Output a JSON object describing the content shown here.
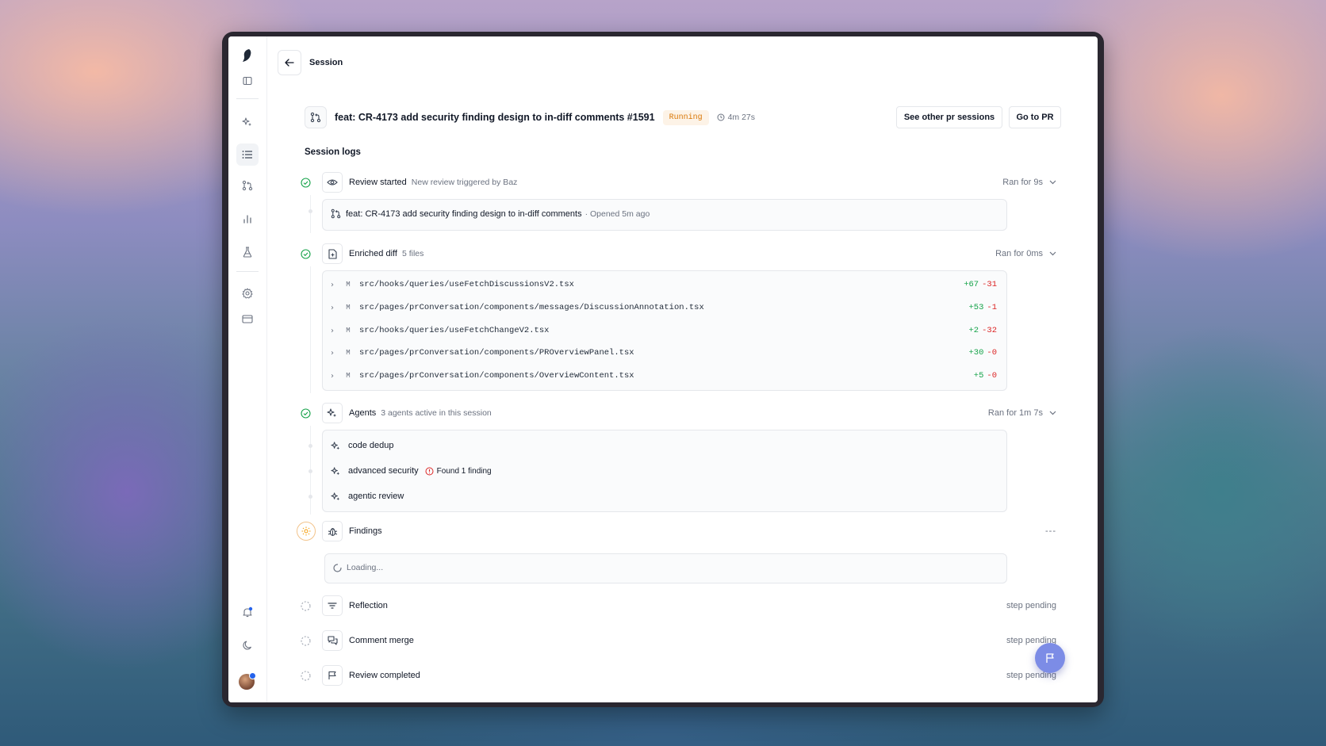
{
  "app": {
    "breadcrumb": "Session"
  },
  "pr": {
    "title": "feat: CR-4173 add security finding design to in-diff comments #1591",
    "status": "Running",
    "duration": "4m 27s",
    "buttons": {
      "other_sessions": "See other pr sessions",
      "go_to_pr": "Go to PR"
    }
  },
  "logs": {
    "title": "Session logs",
    "review_started": {
      "name": "Review started",
      "sub": "New review triggered by Baz",
      "ran": "Ran for 9s",
      "pr_title": "feat: CR-4173 add security finding design to in-diff comments",
      "opened": "· Opened 5m ago"
    },
    "enriched_diff": {
      "name": "Enriched diff",
      "sub": "5 files",
      "ran": "Ran for 0ms",
      "files": [
        {
          "status": "M",
          "path": "src/hooks/queries/useFetchDiscussionsV2.tsx",
          "add": "+67",
          "del": "-31"
        },
        {
          "status": "M",
          "path": "src/pages/prConversation/components/messages/DiscussionAnnotation.tsx",
          "add": "+53",
          "del": "-1"
        },
        {
          "status": "M",
          "path": "src/hooks/queries/useFetchChangeV2.tsx",
          "add": "+2",
          "del": "-32"
        },
        {
          "status": "M",
          "path": "src/pages/prConversation/components/PROverviewPanel.tsx",
          "add": "+30",
          "del": "-0"
        },
        {
          "status": "M",
          "path": "src/pages/prConversation/components/OverviewContent.tsx",
          "add": "+5",
          "del": "-0"
        }
      ]
    },
    "agents": {
      "name": "Agents",
      "sub": "3 agents active in this session",
      "ran": "Ran for 1m 7s",
      "list": [
        {
          "name": "code dedup"
        },
        {
          "name": "advanced security",
          "finding": "Found 1 finding"
        },
        {
          "name": "agentic review"
        }
      ]
    },
    "findings": {
      "name": "Findings",
      "right": "---",
      "loading": "Loading..."
    },
    "reflection": {
      "name": "Reflection",
      "right": "step pending"
    },
    "comment_merge": {
      "name": "Comment merge",
      "right": "step pending"
    },
    "review_completed": {
      "name": "Review completed",
      "right": "step pending"
    }
  },
  "colors": {
    "accent": "#7c8ce6",
    "success": "#16a34a",
    "danger": "#dc2626",
    "warning": "#d97706"
  }
}
